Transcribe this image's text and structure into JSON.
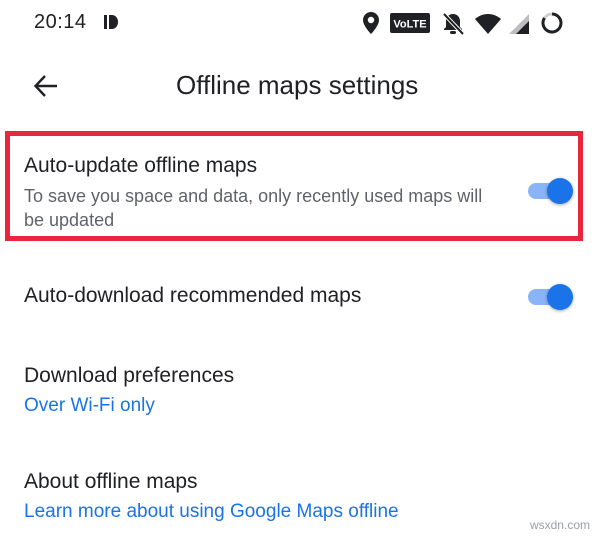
{
  "status_bar": {
    "time": "20:14",
    "volte_label": "VoLTE"
  },
  "header": {
    "title": "Offline maps settings"
  },
  "settings": {
    "auto_update": {
      "title": "Auto-update offline maps",
      "description": "To save you space and data, only recently used maps will be updated",
      "enabled": true
    },
    "auto_download": {
      "title": "Auto-download recommended maps",
      "enabled": true
    },
    "download_preferences": {
      "title": "Download preferences",
      "value": "Over Wi-Fi only"
    },
    "about": {
      "title": "About offline maps",
      "link": "Learn more about using Google Maps offline"
    }
  },
  "watermark": "wsxdn.com",
  "colors": {
    "accent": "#1a73e8",
    "toggle_track": "#8ab4f8",
    "highlight": "#e8273f",
    "secondary_text": "#5f6368"
  }
}
